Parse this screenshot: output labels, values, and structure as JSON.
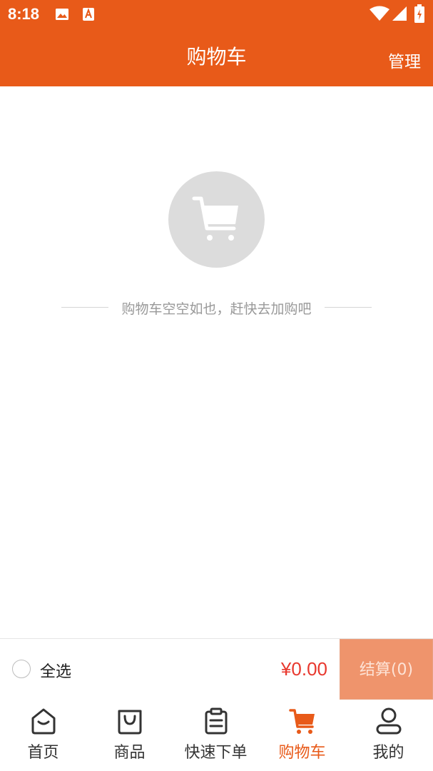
{
  "status_bar": {
    "time": "8:18",
    "icons": [
      "image-icon",
      "a-icon",
      "wifi-icon",
      "signal-icon",
      "battery-charging-icon"
    ]
  },
  "header": {
    "title": "购物车",
    "manage_label": "管理"
  },
  "empty_state": {
    "icon": "shopping-cart-icon",
    "message": "购物车空空如也，赶快去加购吧"
  },
  "checkout": {
    "select_all_label": "全选",
    "total": "¥0.00",
    "button_label": "结算(0)"
  },
  "tabbar": {
    "items": [
      {
        "label": "首页",
        "icon": "home-icon",
        "active": false
      },
      {
        "label": "商品",
        "icon": "shopping-bag-icon",
        "active": false
      },
      {
        "label": "快速下单",
        "icon": "clipboard-icon",
        "active": false
      },
      {
        "label": "购物车",
        "icon": "cart-icon",
        "active": true
      },
      {
        "label": "我的",
        "icon": "user-icon",
        "active": false
      }
    ]
  },
  "colors": {
    "brand": "#e85a19",
    "price": "#e8382e",
    "checkout_button": "#ef946c",
    "empty_circle": "#dcdcdc"
  }
}
